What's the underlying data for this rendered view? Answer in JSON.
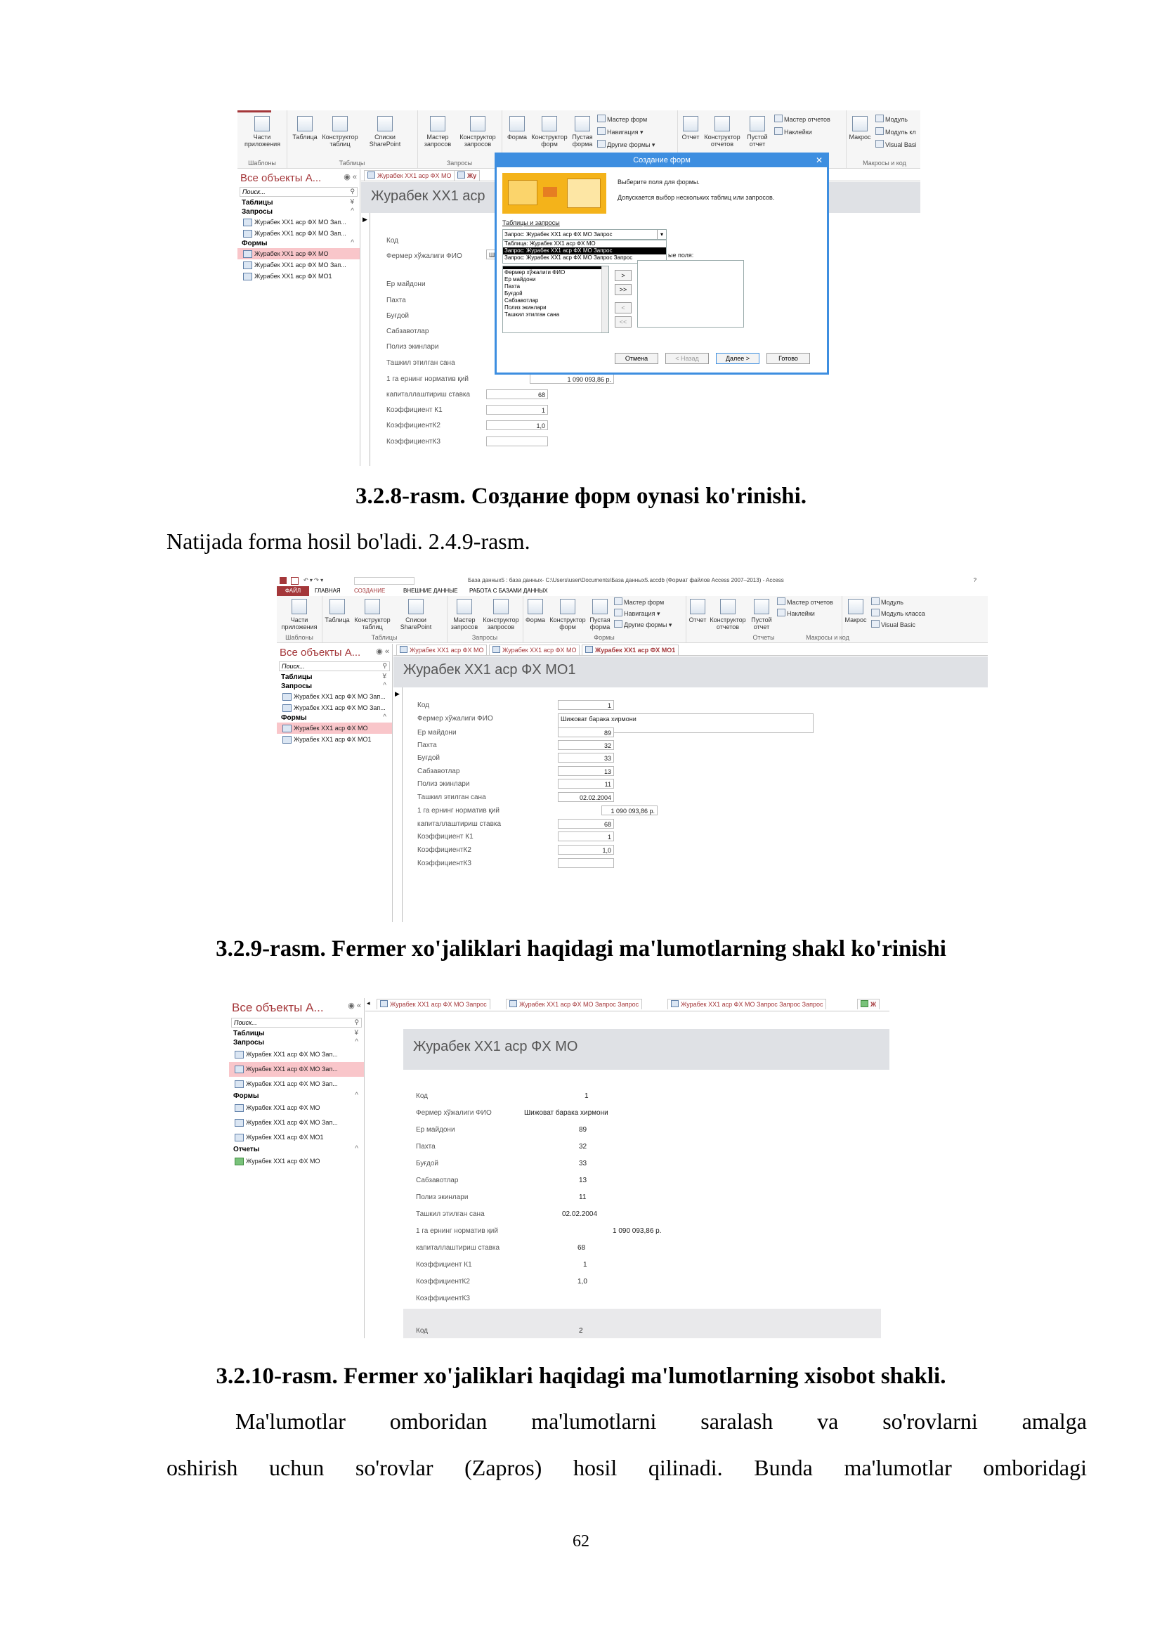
{
  "shot1": {
    "ribbon_buttons": [
      "Части приложения",
      "Таблица",
      "Конструктор таблиц",
      "Списки SharePoint",
      "Мастер запросов",
      "Конструктор запросов",
      "Форма",
      "Конструктор форм",
      "Пустая форма",
      "Отчет",
      "Конструктор отчетов",
      "Пустой отчет",
      "Макрос"
    ],
    "ribbon_small": [
      "Мастер форм",
      "Навигация",
      "Другие формы",
      "Мастер отчетов",
      "Наклейки",
      "Модуль",
      "Модуль кл",
      "Visual Basi"
    ],
    "group_labels": [
      "Шаблоны",
      "Таблицы",
      "Запросы",
      "Макросы и код"
    ],
    "nav": {
      "title": "Все объекты А...",
      "search": "Поиск...",
      "sections": [
        "Таблицы",
        "Запросы",
        "Формы"
      ],
      "items": [
        {
          "label": "Журабек XX1 аср ФХ МО Зап...",
          "kind": "query"
        },
        {
          "label": "Журабек XX1 аср ФХ МО Зап...",
          "kind": "query"
        },
        {
          "label": "Журабек XX1 аср ФХ МО",
          "kind": "form"
        },
        {
          "label": "Журабек XX1 аср ФХ МО Зап...",
          "kind": "form"
        },
        {
          "label": "Журабек XX1 аср ФХ МО1",
          "kind": "form"
        }
      ]
    },
    "tabs": [
      "Журабек XX1 аср ФХ МО",
      "Жу"
    ],
    "form_title": "Журабек XX1 аср",
    "fields": [
      "Код",
      "Фермер хўжалиги ФИО",
      "Ер майдони",
      "Пахта",
      "Буғдой",
      "Сабзавотлар",
      "Полиз экинлари",
      "Ташкил этилган сана",
      "1 га ернинг норматив қий",
      "капиталлаштириш ставка",
      "Коэффициент К1",
      "КоэффициентК2",
      "КоэффициентК3"
    ],
    "values": {
      "norm": "1 090 093,86 р.",
      "stavka": "68",
      "k1": "1",
      "k2": "1,0",
      "fio_fragment": "Ш"
    },
    "dialog": {
      "title": "Создание форм",
      "close": "✕",
      "line1": "Выберите поля для формы.",
      "line2": "Допускается выбор нескольких таблиц или запросов.",
      "tables_label": "Таблицы и запросы",
      "combo_value": "Запрос: Журабек XX1 аср ФХ МО Запрос",
      "dropdown": [
        "Таблица: Журабек XX1 аср ФХ МО",
        "Запрос: Журабек XX1 аср ФХ МО Запрос",
        "Запрос: Журабек XX1 аср ФХ МО Запрос Запрос"
      ],
      "selected_label": "ые поля:",
      "available": [
        "Фермер хўжалиги ФИО",
        "Ер майдони",
        "Пахта",
        "Буғдой",
        "Сабзавотлар",
        "Полиз экинлари",
        "Ташкил этилган сана"
      ],
      "move_buttons": [
        ">",
        ">>",
        "<",
        "<<"
      ],
      "buttons": [
        "Отмена",
        "< Назад",
        "Далее >",
        "Готово"
      ]
    }
  },
  "caption1": "3.2.8-rasm. Создание форм oynasi ko'rinishi.",
  "para1": "Natijada forma hosil bo'ladi. 2.4.9-rasm.",
  "shot2": {
    "qat_title": "База данных5 : база данных- C:\\Users\\user\\Documents\\База данных5.accdb (Формат файлов Access 2007–2013) - Access",
    "help": "?",
    "menu": [
      "ФАЙЛ",
      "ГЛАВНАЯ",
      "СОЗДАНИЕ",
      "ВНЕШНИЕ ДАННЫЕ",
      "РАБОТА С БАЗАМИ ДАННЫХ"
    ],
    "ribbon_buttons": [
      "Части приложения",
      "Таблица",
      "Конструктор таблиц",
      "Списки SharePoint",
      "Мастер запросов",
      "Конструктор запросов",
      "Форма",
      "Конструктор форм",
      "Пустая форма",
      "Отчет",
      "Конструктор отчетов",
      "Пустой отчет",
      "Макрос"
    ],
    "ribbon_small": [
      "Мастер форм",
      "Навигация",
      "Другие формы",
      "Мастер отчетов",
      "Наклейки",
      "Модуль",
      "Модуль класса",
      "Visual Basic"
    ],
    "group_labels": [
      "Шаблоны",
      "Таблицы",
      "Запросы",
      "Формы",
      "Отчеты",
      "Макросы и код"
    ],
    "nav": {
      "title": "Все объекты А...",
      "search": "Поиск...",
      "sections": [
        "Таблицы",
        "Запросы",
        "Формы"
      ],
      "items": [
        {
          "label": "Журабек XX1 аср ФХ МО Зап...",
          "kind": "query"
        },
        {
          "label": "Журабек XX1 аср ФХ МО Зап...",
          "kind": "query"
        },
        {
          "label": "Журабек XX1 аср ФХ МО",
          "kind": "form"
        },
        {
          "label": "Журабек XX1 аср ФХ МО1",
          "kind": "form"
        }
      ]
    },
    "tabs": [
      "Журабек XX1 аср ФХ МО",
      "Журабек XX1 аср ФХ МО",
      "Журабек XX1 аср ФХ МО1"
    ],
    "form_title": "Журабек XX1 аср ФХ МО1",
    "fields": [
      "Код",
      "Фермер хўжалиги ФИО",
      "Ер майдони",
      "Пахта",
      "Буғдой",
      "Сабзавотлар",
      "Полиз экинлари",
      "Ташкил этилган сана",
      "1 га ернинг норматив қий",
      "капиталлаштириш ставка",
      "Коэффициент К1",
      "КоэффициентК2",
      "КоэффициентК3"
    ],
    "values": [
      "1",
      "Шижоват барака хирмони",
      "89",
      "32",
      "33",
      "13",
      "11",
      "02.02.2004",
      "1 090 093,86 р.",
      "68",
      "1",
      "1,0",
      ""
    ]
  },
  "caption2": "3.2.9-rasm. Fermer xo'jaliklari haqidagi ma'lumotlarning shakl ko'rinishi",
  "shot3": {
    "nav": {
      "title": "Все объекты А...",
      "search": "Поиск...",
      "sections": [
        "Таблицы",
        "Запросы",
        "Формы",
        "Отчеты"
      ],
      "items": [
        {
          "label": "Журабек XX1 аср ФХ МО Зап...",
          "kind": "query"
        },
        {
          "label": "Журабек XX1 аср ФХ МО Зап...",
          "kind": "query"
        },
        {
          "label": "Журабек XX1 аср ФХ МО Зап...",
          "kind": "query"
        },
        {
          "label": "Журабек XX1 аср ФХ МО",
          "kind": "form"
        },
        {
          "label": "Журабек XX1 аср ФХ МО Зап...",
          "kind": "form"
        },
        {
          "label": "Журабек XX1 аср ФХ МО1",
          "kind": "form"
        },
        {
          "label": "Журабек XX1 аср ФХ МО",
          "kind": "report"
        }
      ]
    },
    "tabs": [
      "Журабек XX1 аср ФХ МО Запрос",
      "Журабек XX1 аср ФХ МО Запрос Запрос",
      "Журабек XX1 аср ФХ МО Запрос Запрос Запрос",
      "Ж"
    ],
    "report_title": "Журабек XX1 аср ФХ МО",
    "fields": [
      "Код",
      "Фермер хўжалиги ФИО",
      "Ер майдони",
      "Пахта",
      "Буғдой",
      "Сабзавотлар",
      "Полиз экинлари",
      "Ташкил этилган сана",
      "1 га ернинг норматив қий",
      "капиталлаштириш ставка",
      "Коэффициент К1",
      "КоэффициентК2",
      "КоэффициентК3"
    ],
    "values": [
      "1",
      "Шижоват барака хирмони",
      "89",
      "32",
      "33",
      "13",
      "11",
      "02.02.2004",
      "1 090 093,86 р.",
      "68",
      "1",
      "1,0",
      ""
    ],
    "next_label": "Код",
    "next_value": "2"
  },
  "caption3": "3.2.10-rasm. Fermer xo'jaliklari haqidagi ma'lumotlarning xisobot shakli.",
  "para2_words": [
    "Ma'lumotlar",
    "omboridan",
    "ma'lumotlarni",
    "saralash",
    "va",
    "so'rovlarni",
    "amalga"
  ],
  "para3_words": [
    "oshirish",
    "uchun",
    "so'rovlar",
    "(Zapros)",
    "hosil",
    "qilinadi.",
    "Bunda",
    "ma'lumotlar",
    "omboridagi"
  ],
  "page_number": "62"
}
